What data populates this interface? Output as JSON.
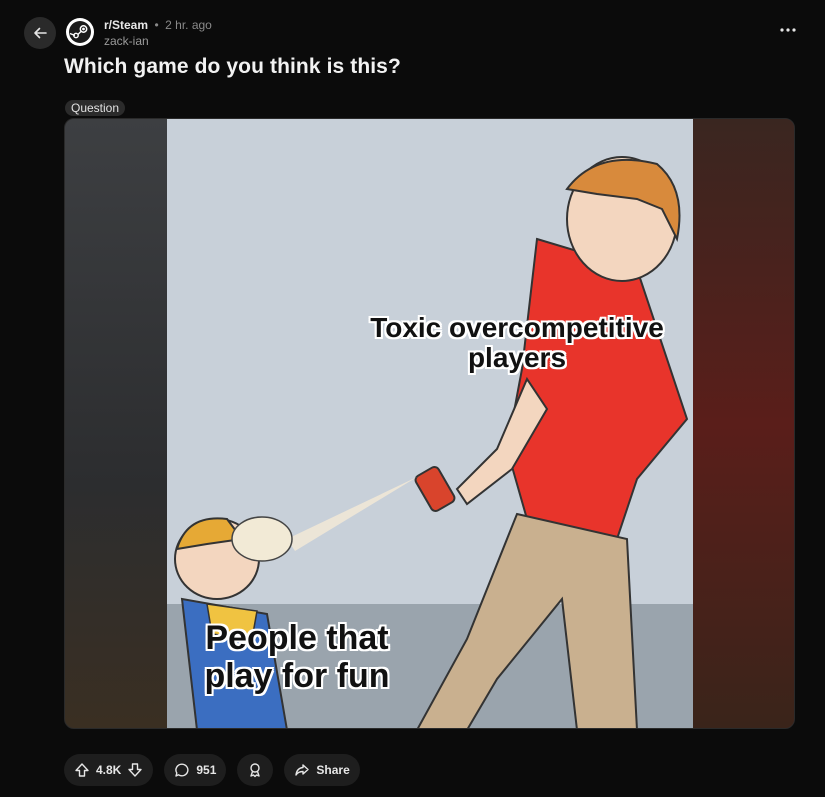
{
  "post": {
    "subreddit": "r/Steam",
    "separator": "•",
    "time": "2 hr. ago",
    "author": "zack-ian",
    "title": "Which game do you think is this?",
    "flair": "Question"
  },
  "meme": {
    "top_caption": "Toxic overcompetitive players",
    "bottom_caption": "People that play for fun"
  },
  "actions": {
    "votes": "4.8K",
    "comments": "951",
    "share": "Share"
  },
  "icons": {
    "back": "arrow-left-icon",
    "more": "ellipsis-icon",
    "upvote": "arrow-up-icon",
    "downvote": "arrow-down-icon",
    "comment": "comment-bubble-icon",
    "award": "award-icon",
    "share": "share-arrow-icon"
  }
}
